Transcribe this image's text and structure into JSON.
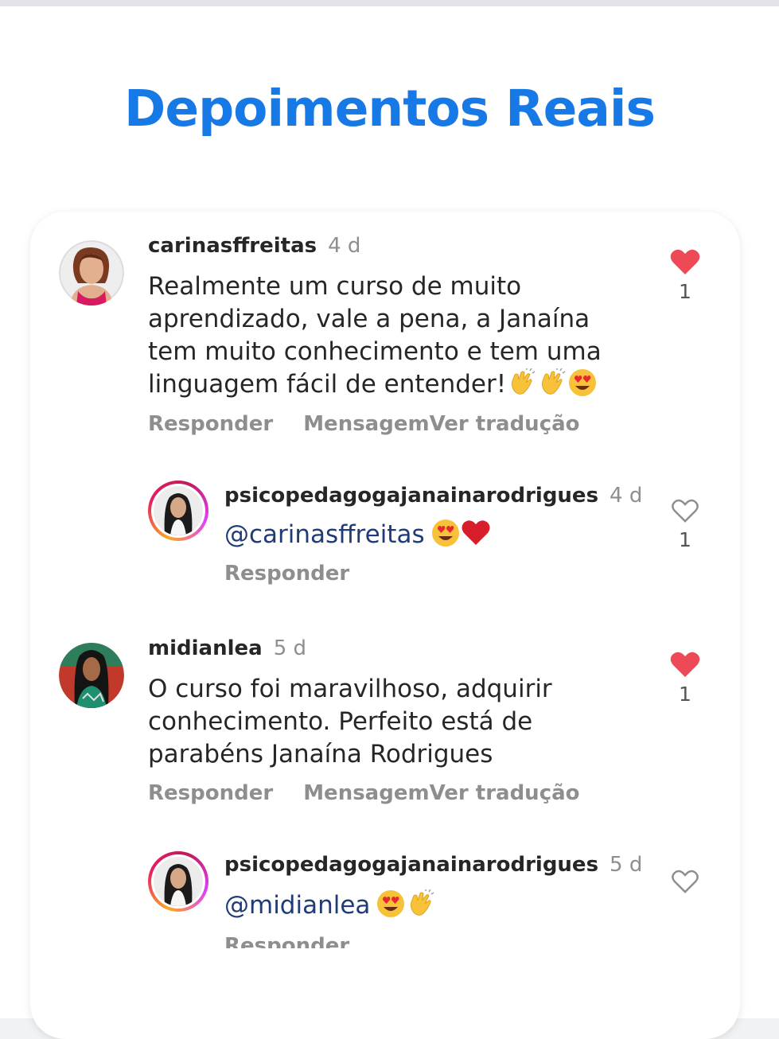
{
  "page": {
    "title": "Depoimentos Reais",
    "accent_color": "#1779e6"
  },
  "comments": [
    {
      "username": "carinasffreitas",
      "time": "4 d",
      "text": "Realmente um curso de muito aprendizado, vale a pena, a Janaína tem muito conhecimento e tem uma linguagem fácil de entender!",
      "emojis": [
        "clapping-hands",
        "clapping-hands",
        "heart-eyes"
      ],
      "liked": true,
      "like_count": "1",
      "actions": [
        "Responder",
        "Mensagem",
        "Ver tradução"
      ]
    },
    {
      "username": "psicopedagogajanainarodrigues",
      "time": "4 d",
      "mention": "@carinasffreitas",
      "emojis": [
        "heart-eyes",
        "red-heart"
      ],
      "liked": false,
      "like_count": "1",
      "actions": [
        "Responder"
      ]
    },
    {
      "username": "midianlea",
      "time": "5 d",
      "text": "O curso foi maravilhoso, adquirir conhecimento. Perfeito está de parabéns Janaína Rodrigues",
      "liked": true,
      "like_count": "1",
      "actions": [
        "Responder",
        "Mensagem",
        "Ver tradução"
      ]
    },
    {
      "username": "psicopedagogajanainarodrigues",
      "time": "5 d",
      "mention": "@midianlea",
      "emojis": [
        "heart-eyes",
        "clapping-hands"
      ],
      "liked": false,
      "actions": [
        "Responder"
      ]
    }
  ]
}
